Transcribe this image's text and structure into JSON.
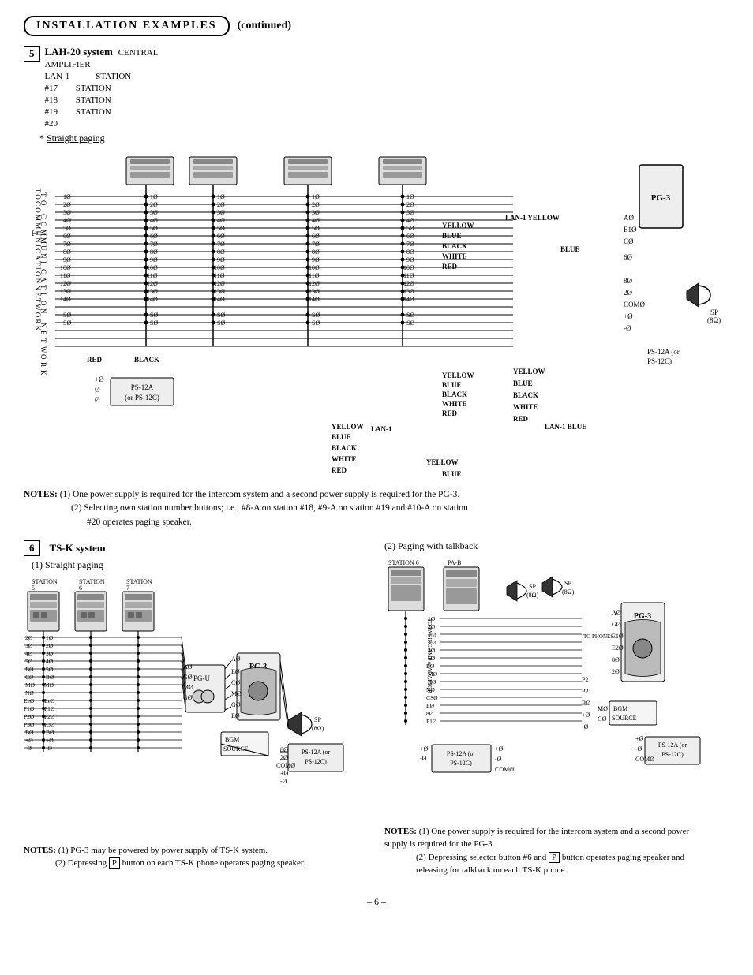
{
  "header": {
    "title": "INSTALLATION EXAMPLES",
    "continued": "(continued)"
  },
  "section5": {
    "number": "5",
    "title": "LAH-20 system",
    "subtitle_line1": "CENTRAL",
    "subtitle_line2": "AMPLIFIER",
    "subtitle_line3": "LAN-1",
    "star_label": "Straight paging",
    "stations": [
      "STATION #17",
      "STATION #18",
      "STATION #19",
      "STATION #20"
    ],
    "components": [
      "PG-3",
      "LAN-1",
      "PS-12A (or PS-12C)"
    ],
    "wire_colors": [
      "YELLOW",
      "BLUE",
      "BLACK",
      "WHITE",
      "RED"
    ],
    "speaker_label": "SP (8Ω)"
  },
  "notes1": {
    "label": "NOTES:",
    "note1": "(1) One power supply is required for the intercom system and a second power supply is required for the PG-3.",
    "note2": "(2) Selecting own station number buttons; i.e., #8-A on station #18, #9-A on station #19 and #10-A on station #20 operates paging speaker."
  },
  "section6": {
    "number": "6",
    "title": "TS-K system",
    "subsection1": {
      "label": "(1) Straight paging",
      "stations": [
        "STATION 5",
        "STATION 6",
        "STATION 7"
      ],
      "components": [
        "PG-U",
        "PG-3",
        "BGM SOURCE",
        "SP (8Ω)",
        "PS-12A (or PS-12C)"
      ]
    },
    "subsection2": {
      "label": "(2) Paging with talkback",
      "stations": [
        "STATION 6",
        "PA-B"
      ],
      "components": [
        "PG-3",
        "BGM SOURCE",
        "SP (8Ω)",
        "PS-12A (or PS-12C)"
      ],
      "labels": [
        "TO PAGING AMP or ADAPTOR",
        "TO PHONES"
      ]
    },
    "notes_left": {
      "label": "NOTES:",
      "note1": "(1) PG-3 may be powered by power supply of TS-K system.",
      "note2": "(2) Depressing",
      "p_button": "P",
      "note2b": "button on each TS-K phone operates paging speaker."
    },
    "notes_right": {
      "label": "NOTES:",
      "note1": "(1) One power supply is required for the intercom system and a second power supply is required for the PG-3.",
      "note2": "(2) Depressing selector button #6 and",
      "p_button": "P",
      "note2b": "button operates paging speaker and releasing for talkback on each TS-K phone."
    }
  },
  "page_number": "– 6 –"
}
